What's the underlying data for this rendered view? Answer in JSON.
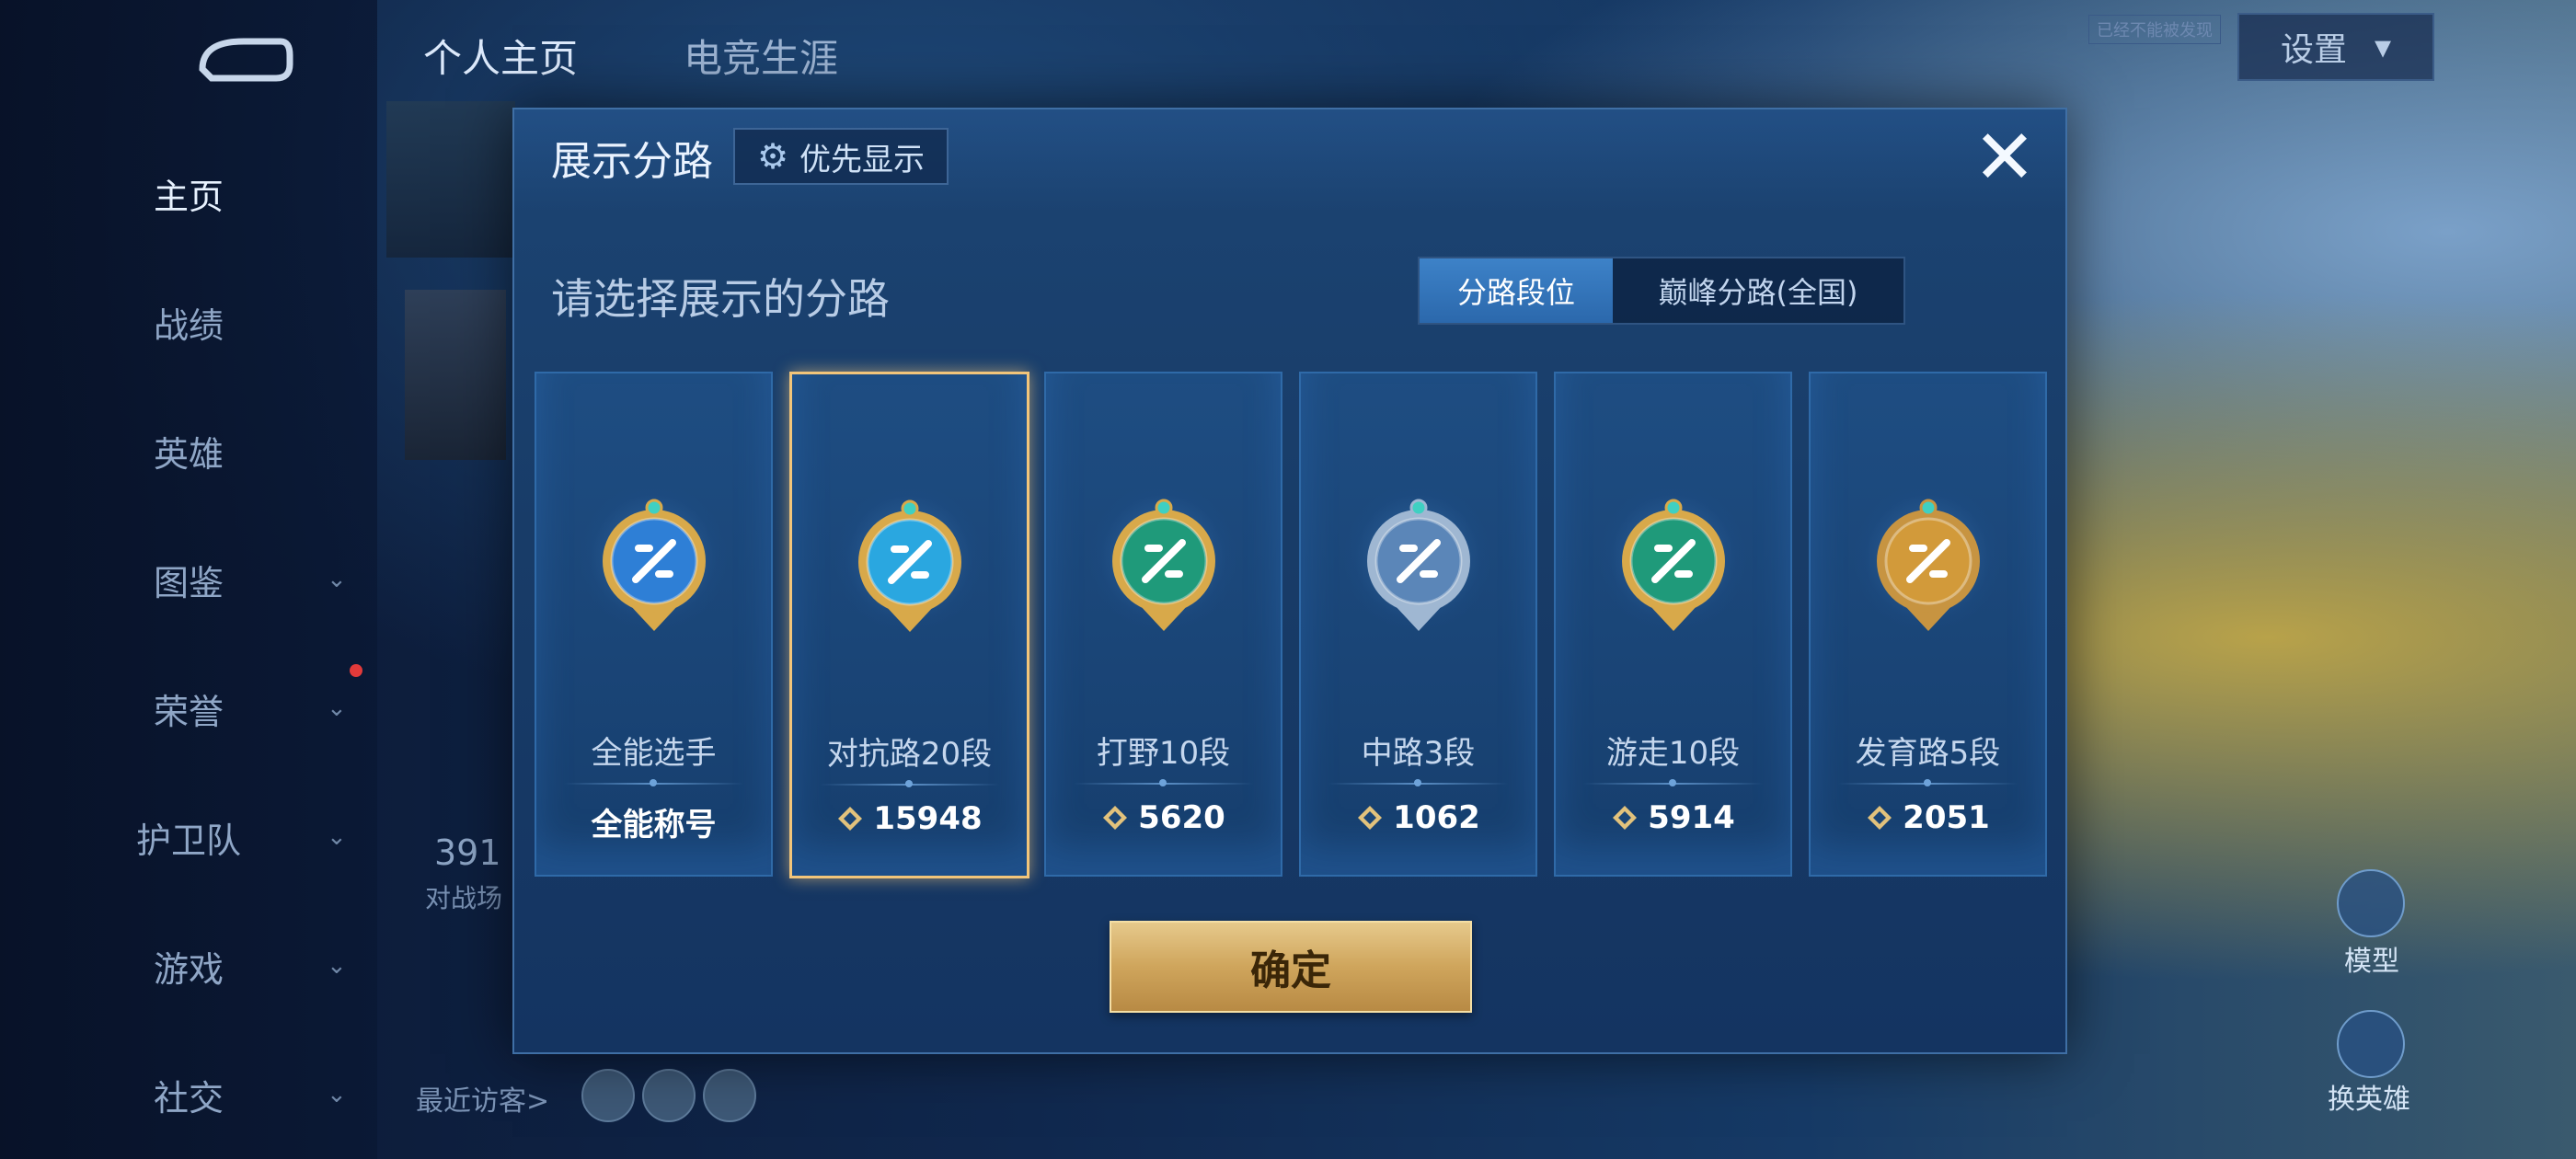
{
  "top_tabs": [
    "个人主页",
    "电竞生涯"
  ],
  "settings": {
    "label": "设置",
    "small_tag": "已经不能被发现"
  },
  "sidebar": {
    "items": [
      {
        "label": "主页",
        "active": true,
        "has_chevron": false
      },
      {
        "label": "战绩",
        "active": false,
        "has_chevron": false
      },
      {
        "label": "英雄",
        "active": false,
        "has_chevron": false
      },
      {
        "label": "图鉴",
        "active": false,
        "has_chevron": true
      },
      {
        "label": "荣誉",
        "active": false,
        "has_chevron": true
      },
      {
        "label": "护卫队",
        "active": false,
        "has_chevron": true
      },
      {
        "label": "游戏",
        "active": false,
        "has_chevron": true
      },
      {
        "label": "社交",
        "active": false,
        "has_chevron": true
      }
    ]
  },
  "background": {
    "stat_number": "391",
    "stat_label": "对战场",
    "visitors_label": "最近访客>",
    "right_buttons": [
      "模型",
      "换英雄"
    ]
  },
  "modal": {
    "title": "展示分路",
    "priority_label": "优先显示",
    "subtitle": "请选择展示的分路",
    "segment": {
      "active": "分路段位",
      "inactive": "巅峰分路(全国)"
    },
    "cards": [
      {
        "name": "全能选手",
        "value": "全能称号",
        "has_points": false,
        "selected": false,
        "badge_color": "#2e7fd6",
        "rim": "#d8a94a"
      },
      {
        "name": "对抗路20段",
        "value": "15948",
        "has_points": true,
        "selected": true,
        "badge_color": "#2aa7e0",
        "rim": "#d8a94a"
      },
      {
        "name": "打野10段",
        "value": "5620",
        "has_points": true,
        "selected": false,
        "badge_color": "#1f9a7a",
        "rim": "#d8a94a"
      },
      {
        "name": "中路3段",
        "value": "1062",
        "has_points": true,
        "selected": false,
        "badge_color": "#5b86b8",
        "rim": "#9fb7d2"
      },
      {
        "name": "游走10段",
        "value": "5914",
        "has_points": true,
        "selected": false,
        "badge_color": "#1f9a7a",
        "rim": "#d8a94a"
      },
      {
        "name": "发育路5段",
        "value": "2051",
        "has_points": true,
        "selected": false,
        "badge_color": "#d29a3a",
        "rim": "#c79441"
      }
    ],
    "confirm_label": "确定"
  }
}
